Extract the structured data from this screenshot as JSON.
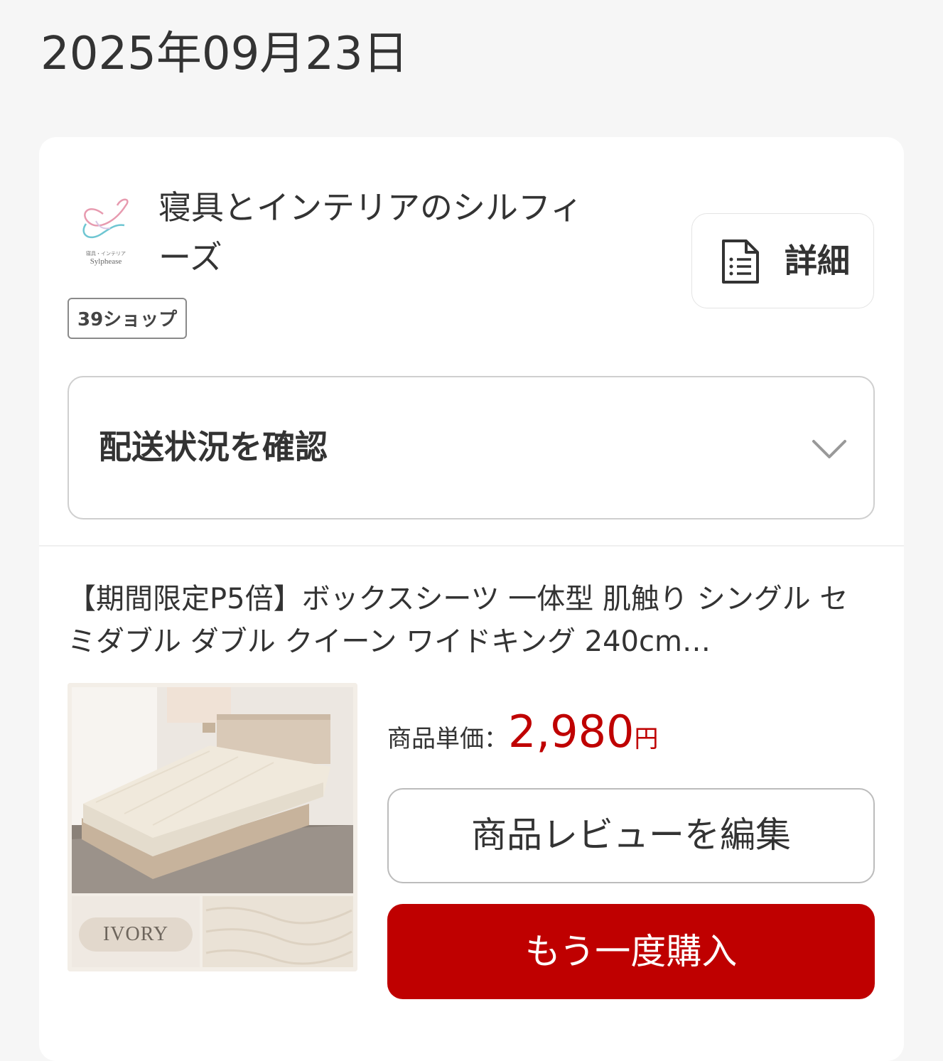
{
  "order": {
    "date": "2025年09月23日"
  },
  "shop": {
    "name": "寝具とインテリアのシルフィーズ",
    "logo_text": "Sylphease",
    "logo_subtext": "寝具・インテリア",
    "badge": "39ショップ",
    "detail_label": "詳細"
  },
  "shipping": {
    "label": "配送状況を確認"
  },
  "product": {
    "title": "【期間限定P5倍】ボックスシーツ 一体型 肌触り シングル セミダブル ダブル クイーン ワイドキング 240cm…",
    "image_label": "IVORY",
    "price_label": "商品単価：",
    "price_value": "2,980",
    "price_unit": "円",
    "review_button": "商品レビューを編集",
    "rebuy_button": "もう一度購入"
  },
  "colors": {
    "accent": "#bf0000",
    "text": "#333333",
    "background": "#f6f6f6"
  },
  "icons": {
    "detail": "document-list-icon",
    "shipping": "chevron-down-icon"
  }
}
